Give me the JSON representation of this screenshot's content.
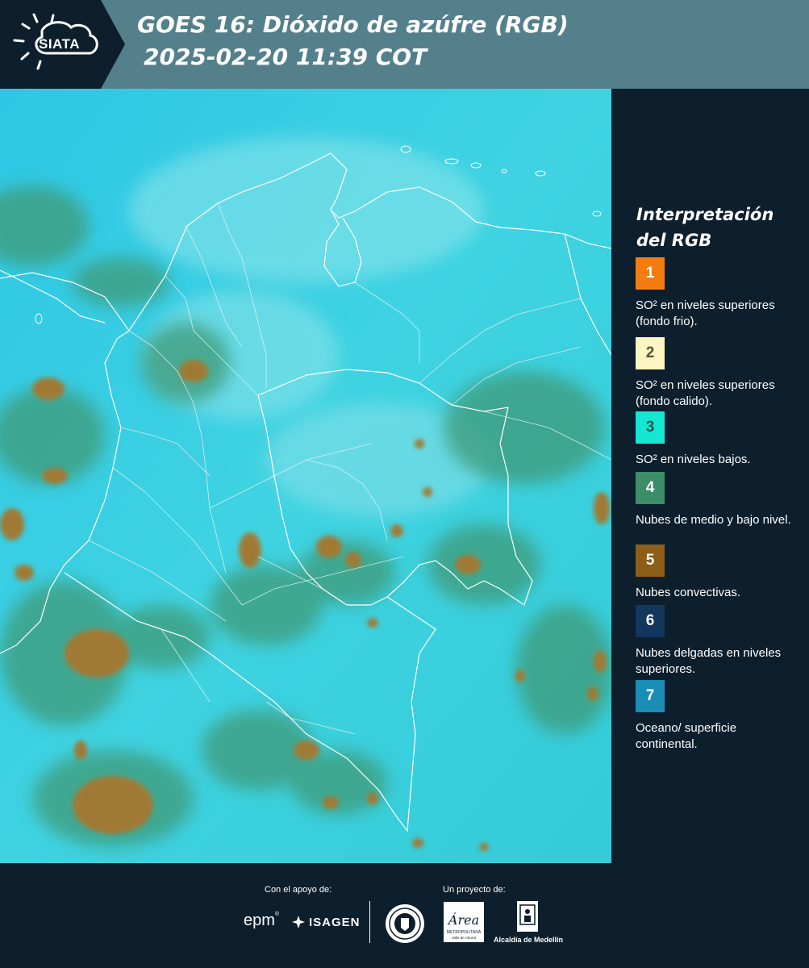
{
  "header": {
    "logo_text": "SIATA",
    "title_line1": "GOES 16: Dióxido de azúfre (RGB)",
    "title_line2": "2025-02-20 11:39 COT"
  },
  "map": {
    "background_color": "#36cfe4",
    "border_color": "#ffffff",
    "icon": "satellite-map"
  },
  "legend": {
    "title_line1": "Interpretación",
    "title_line2": "del RGB",
    "items": [
      {
        "number": "1",
        "color": "#f47d12",
        "text_color": "#ffffff",
        "description": "SO² en niveles superiores (fondo frio)."
      },
      {
        "number": "2",
        "color": "#fbf5c2",
        "text_color": "#53533c",
        "description": "SO² en niveles superiores (fondo calido)."
      },
      {
        "number": "3",
        "color": "#14e6d2",
        "text_color": "#1b5b55",
        "description": "SO² en niveles bajos."
      },
      {
        "number": "4",
        "color": "#3b8e68",
        "text_color": "#ffffff",
        "description": "Nubes de medio y bajo nivel."
      },
      {
        "number": "5",
        "color": "#8c5e18",
        "text_color": "#ffffff",
        "description": "Nubes convectivas."
      },
      {
        "number": "6",
        "color": "#13365c",
        "text_color": "#ffffff",
        "description": "Nubes delgadas en niveles superiores."
      },
      {
        "number": "7",
        "color": "#1a8db6",
        "text_color": "#ffffff",
        "description": "Oceano/ superficie continental."
      }
    ]
  },
  "footer": {
    "support_label": "Con el apoyo de:",
    "project_label": "Un proyecto de:",
    "epm_text": "epm",
    "isagen_text": "ISAGEN",
    "area_text": "Área",
    "area_subtext": "METROPOLITANA",
    "area_subtext2": "Valle de Aburrá",
    "alcaldia_text": "Alcaldía de Medellín"
  },
  "colors": {
    "header_bg": "#54808c",
    "dark_bg": "#0d1f2d",
    "cloud_green": "#4a9a78",
    "convective_brown": "#9c7a33"
  }
}
